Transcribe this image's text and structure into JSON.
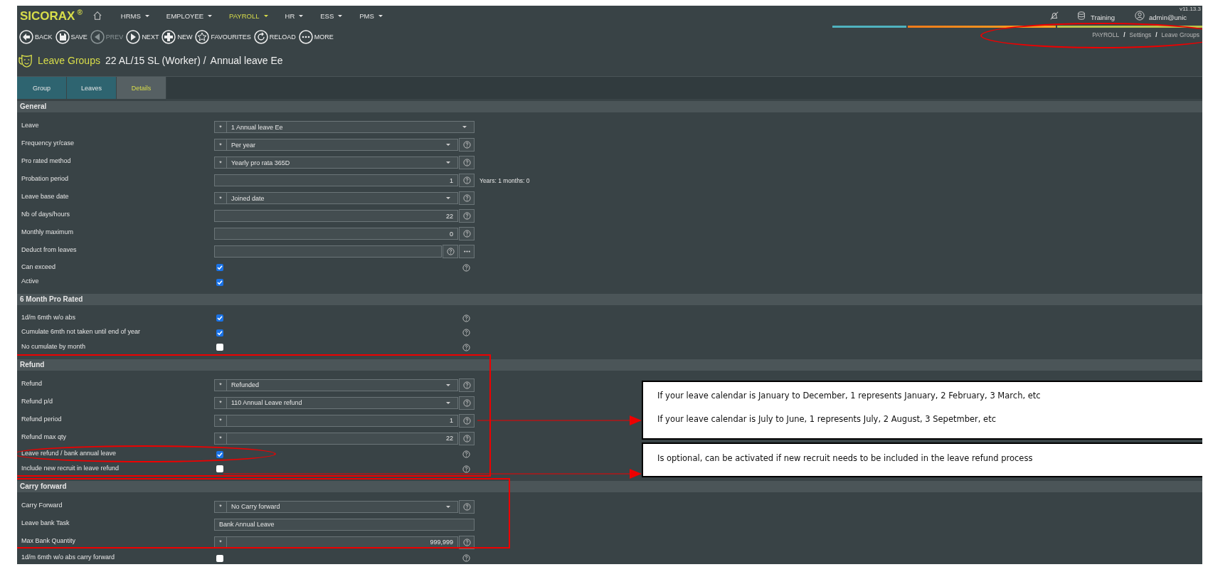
{
  "header": {
    "logo": "SICORAX",
    "logo_mark": "®",
    "menu": [
      {
        "label": "HRMS",
        "selected": false
      },
      {
        "label": "EMPLOYEE",
        "selected": false
      },
      {
        "label": "PAYROLL",
        "selected": true
      },
      {
        "label": "HR",
        "selected": false
      },
      {
        "label": "ESS",
        "selected": false
      },
      {
        "label": "PMS",
        "selected": false
      }
    ],
    "environment": "Training",
    "user": "admin@unic",
    "version": "v11.13.3"
  },
  "toolbar": [
    {
      "kind": "back",
      "label": "BACK",
      "disabled": false
    },
    {
      "kind": "save",
      "label": "SAVE",
      "disabled": false
    },
    {
      "kind": "prev",
      "label": "PREV",
      "disabled": true
    },
    {
      "kind": "next",
      "label": "NEXT",
      "disabled": false
    },
    {
      "kind": "new",
      "label": "NEW",
      "disabled": false
    },
    {
      "kind": "favourites",
      "label": "FAVOURITES",
      "disabled": false
    },
    {
      "kind": "reload",
      "label": "RELOAD",
      "disabled": false
    },
    {
      "kind": "more",
      "label": "MORE",
      "disabled": false
    }
  ],
  "breadcrumb": {
    "items": [
      "PAYROLL",
      "Settings",
      "Leave Groups"
    ],
    "separator": "/"
  },
  "title": {
    "module": "Leave Groups",
    "record": "22 AL/15 SL (Worker) /",
    "sub": "Annual leave Ee"
  },
  "tabs": [
    {
      "label": "Group",
      "selected": false
    },
    {
      "label": "Leaves",
      "selected": false
    },
    {
      "label": "Details",
      "selected": true
    }
  ],
  "sections": [
    {
      "title": "General",
      "rows": [
        {
          "kind": "select",
          "label": "Leave",
          "marker": "*",
          "value": "1 Annual leave Ee",
          "help": false
        },
        {
          "kind": "select",
          "label": "Frequency yr/case",
          "marker": "*",
          "value": "Per year",
          "help": true
        },
        {
          "kind": "select",
          "label": "Pro rated method",
          "marker": "*",
          "value": "Yearly pro rata 365D",
          "help": true
        },
        {
          "kind": "number",
          "label": "Probation period",
          "value": "1",
          "help": true,
          "note": "Years: 1 months: 0"
        },
        {
          "kind": "select",
          "label": "Leave base date",
          "marker": "*",
          "value": "Joined date",
          "help": true
        },
        {
          "kind": "number",
          "label": "Nb of days/hours",
          "value": "22",
          "help": true
        },
        {
          "kind": "number",
          "label": "Monthly maximum",
          "value": "0",
          "help": true
        },
        {
          "kind": "lookup",
          "label": "Deduct from leaves",
          "help": true
        },
        {
          "kind": "checkbox",
          "label": "Can exceed",
          "checked": true,
          "help": true
        },
        {
          "kind": "checkbox",
          "label": "Active",
          "checked": true,
          "help": false
        }
      ]
    },
    {
      "title": "6 Month Pro Rated",
      "rows": [
        {
          "kind": "checkbox",
          "label": "1d/m 6mth w/o abs",
          "checked": true,
          "help": true
        },
        {
          "kind": "checkbox",
          "label": "Cumulate 6mth not taken until end of year",
          "checked": true,
          "help": true
        },
        {
          "kind": "checkbox",
          "label": "No cumulate by month",
          "checked": false,
          "help": true
        }
      ]
    },
    {
      "title": "Refund",
      "rows": [
        {
          "kind": "select",
          "label": "Refund",
          "marker": "*",
          "value": "Refunded",
          "help": true
        },
        {
          "kind": "select",
          "label": "Refund p/d",
          "marker": "*",
          "value": "110 Annual Leave refund",
          "help": true
        },
        {
          "kind": "number",
          "label": "Refund period",
          "marker": "*",
          "value": "1",
          "help": true
        },
        {
          "kind": "number",
          "label": "Refund max qty",
          "marker": "*",
          "value": "22",
          "help": true
        },
        {
          "kind": "checkbox",
          "label": "Leave refund / bank annual leave",
          "checked": true,
          "help": true
        },
        {
          "kind": "checkbox",
          "label": "Include new recruit in leave refund",
          "checked": false,
          "help": true
        }
      ]
    },
    {
      "title": "Carry forward",
      "rows": [
        {
          "kind": "select",
          "label": "Carry Forward",
          "marker": "*",
          "value": "No Carry forward",
          "help": true
        },
        {
          "kind": "text",
          "label": "Leave bank Task",
          "value": "Bank Annual Leave",
          "help": false
        },
        {
          "kind": "number",
          "label": "Max Bank Quantity",
          "marker": "*",
          "value": "999,999",
          "help": true
        },
        {
          "kind": "checkbox",
          "label": "1d/m 6mth w/o abs carry forward",
          "checked": false,
          "help": true
        }
      ]
    }
  ],
  "callouts": [
    {
      "lines": [
        "If your leave calendar is January to December, 1 represents January, 2 February, 3 March, etc",
        "If your leave calendar is July to June, 1 represents July, 2 August, 3 Sepetmber, etc"
      ]
    },
    {
      "lines": [
        "Is optional, can be activated if new recruit needs to be included in the leave refund process"
      ]
    }
  ]
}
